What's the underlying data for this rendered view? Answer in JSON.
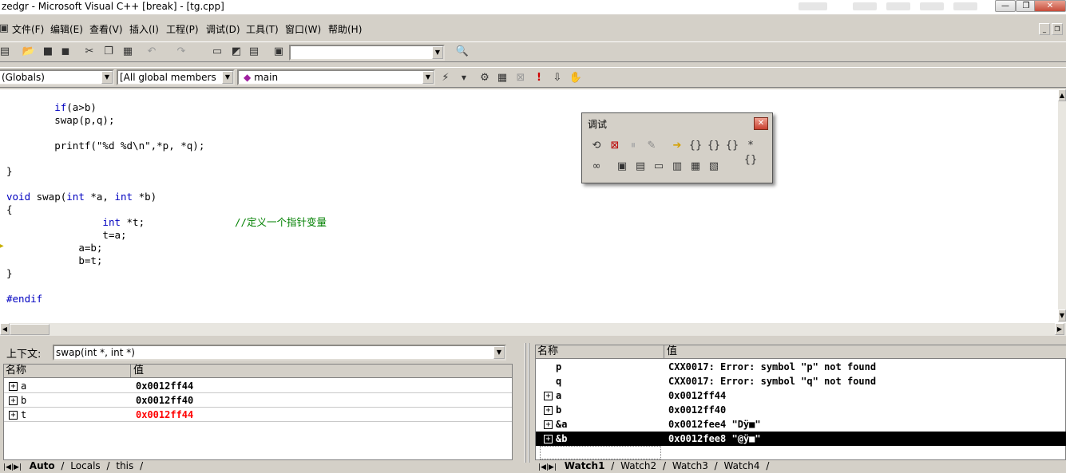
{
  "window": {
    "title": "zedgr - Microsoft Visual C++ [break] - [tg.cpp]",
    "buttons": {
      "minimize": "—",
      "restore": "❐",
      "close": "✕"
    }
  },
  "menu": {
    "items": [
      "文件(F)",
      "编辑(E)",
      "查看(V)",
      "插入(I)",
      "工程(P)",
      "调试(D)",
      "工具(T)",
      "窗口(W)",
      "帮助(H)"
    ]
  },
  "wizard_bar": {
    "globals": "(Globals)",
    "members": "[All global members",
    "function": "main"
  },
  "editor": {
    "lines": [
      {
        "indent": "        ",
        "parts": [
          {
            "t": "kw",
            "v": "if"
          },
          {
            "t": "n",
            "v": "(a>b)"
          }
        ]
      },
      {
        "indent": "        ",
        "parts": [
          {
            "t": "n",
            "v": "swap(p,q);"
          }
        ]
      },
      {
        "indent": "",
        "parts": []
      },
      {
        "indent": "        ",
        "parts": [
          {
            "t": "n",
            "v": "printf(\"%d %d\\n\",*p, *q);"
          }
        ]
      },
      {
        "indent": "",
        "parts": []
      },
      {
        "indent": "",
        "parts": [
          {
            "t": "n",
            "v": "}"
          }
        ]
      },
      {
        "indent": "",
        "parts": []
      },
      {
        "indent": "",
        "parts": [
          {
            "t": "kw",
            "v": "void"
          },
          {
            "t": "n",
            "v": " swap("
          },
          {
            "t": "kw",
            "v": "int"
          },
          {
            "t": "n",
            "v": " *a, "
          },
          {
            "t": "kw",
            "v": "int"
          },
          {
            "t": "n",
            "v": " *b)"
          }
        ]
      },
      {
        "indent": "",
        "parts": [
          {
            "t": "n",
            "v": "{"
          }
        ]
      },
      {
        "indent": "                ",
        "parts": [
          {
            "t": "kw",
            "v": "int"
          },
          {
            "t": "n",
            "v": " *t;               "
          },
          {
            "t": "cm",
            "v": "//定义一个指针变量"
          }
        ]
      },
      {
        "indent": "                ",
        "parts": [
          {
            "t": "n",
            "v": "t=a;"
          }
        ]
      },
      {
        "indent": "            ",
        "parts": [
          {
            "t": "n",
            "v": "a=b;"
          }
        ]
      },
      {
        "indent": "            ",
        "parts": [
          {
            "t": "n",
            "v": "b=t;"
          }
        ]
      },
      {
        "indent": "",
        "parts": [
          {
            "t": "n",
            "v": "}"
          }
        ]
      },
      {
        "indent": "",
        "parts": []
      },
      {
        "indent": "",
        "parts": [
          {
            "t": "kw",
            "v": "#endif"
          }
        ]
      }
    ]
  },
  "debug_toolbar": {
    "title": "调试"
  },
  "variables_panel": {
    "context_label": "上下文:",
    "context_value": "swap(int *, int *)",
    "col_name": "名称",
    "col_value": "值",
    "rows": [
      {
        "name": "a",
        "value": "0x0012ff44",
        "changed": false
      },
      {
        "name": "b",
        "value": "0x0012ff40",
        "changed": false
      },
      {
        "name": "t",
        "value": "0x0012ff44",
        "changed": true
      }
    ],
    "tabs": [
      "Auto",
      "Locals",
      "this"
    ]
  },
  "watch_panel": {
    "col_name": "名称",
    "col_value": "值",
    "rows": [
      {
        "name": "p",
        "value": "CXX0017: Error: symbol \"p\" not found",
        "expandable": false,
        "selected": false
      },
      {
        "name": "q",
        "value": "CXX0017: Error: symbol \"q\" not found",
        "expandable": false,
        "selected": false
      },
      {
        "name": "a",
        "value": "0x0012ff44",
        "expandable": true,
        "selected": false
      },
      {
        "name": "b",
        "value": "0x0012ff40",
        "expandable": true,
        "selected": false
      },
      {
        "name": "&a",
        "value": "0x0012fee4 \"Dÿ■\"",
        "expandable": true,
        "selected": false
      },
      {
        "name": "&b",
        "value": "0x0012fee8 \"@ÿ■\"",
        "expandable": true,
        "selected": true
      }
    ],
    "tabs": [
      "Watch1",
      "Watch2",
      "Watch3",
      "Watch4"
    ]
  },
  "colors": {
    "keyword": "#0000c0",
    "comment": "#008000",
    "changed_value": "#ff0000"
  }
}
